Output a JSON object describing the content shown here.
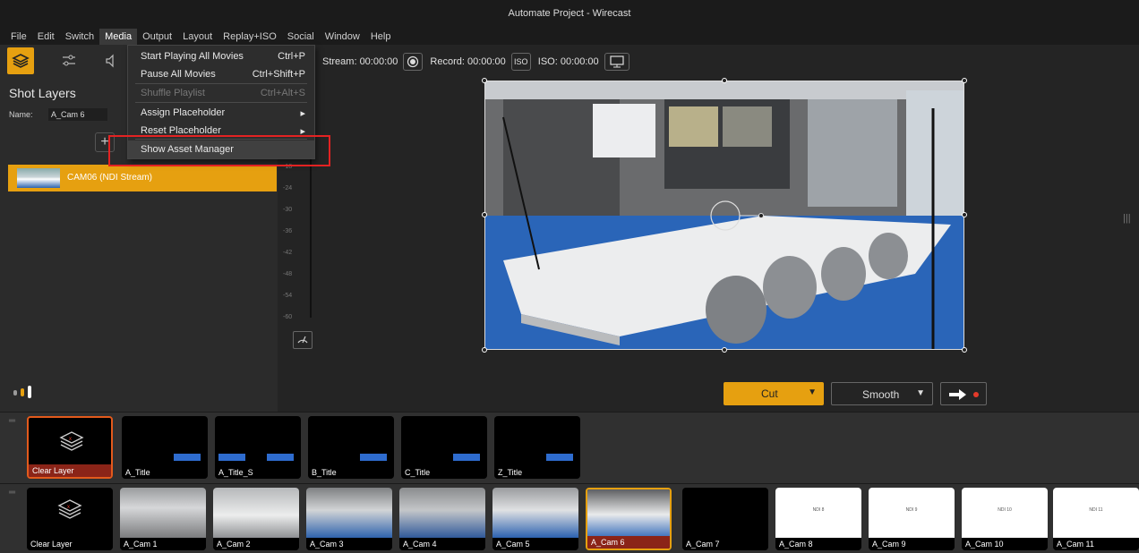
{
  "window": {
    "title": "Automate Project - Wirecast"
  },
  "menubar": {
    "items": [
      "File",
      "Edit",
      "Switch",
      "Media",
      "Output",
      "Layout",
      "Replay+ISO",
      "Social",
      "Window",
      "Help"
    ],
    "active": "Media"
  },
  "media_menu": {
    "items": [
      {
        "label": "Start Playing All Movies",
        "shortcut": "Ctrl+P",
        "enabled": true,
        "submenu": false
      },
      {
        "label": "Pause All Movies",
        "shortcut": "Ctrl+Shift+P",
        "enabled": true,
        "submenu": false
      },
      {
        "label": "Shuffle Playlist",
        "shortcut": "Ctrl+Alt+S",
        "enabled": false,
        "submenu": false
      },
      {
        "label": "Assign Placeholder",
        "shortcut": "",
        "enabled": true,
        "submenu": true
      },
      {
        "label": "Reset Placeholder",
        "shortcut": "",
        "enabled": true,
        "submenu": true
      },
      {
        "label": "Show Asset Manager",
        "shortcut": "",
        "enabled": true,
        "submenu": false,
        "highlighted": true
      }
    ]
  },
  "left_panel": {
    "title": "Shot Layers",
    "name_label": "Name:",
    "name_value": "A_Cam 6",
    "add_button": "+",
    "layer": {
      "label": "CAM06 (NDI Stream)"
    }
  },
  "meter": {
    "ticks": [
      "-18",
      "-24",
      "-30",
      "-36",
      "-42",
      "-48",
      "-54",
      "-60"
    ]
  },
  "status": {
    "stream": "Stream: 00:00:00",
    "record": "Record: 00:00:00",
    "iso": "ISO: 00:00:00",
    "iso_badge": "ISO"
  },
  "transition": {
    "cut": "Cut",
    "smooth": "Smooth"
  },
  "strip1": {
    "shots": [
      "Clear Layer",
      "A_Title",
      "A_Title_S",
      "B_Title",
      "C_Title",
      "Z_Title"
    ]
  },
  "strip2": {
    "shots": [
      "Clear Layer",
      "A_Cam 1",
      "A_Cam 2",
      "A_Cam 3",
      "A_Cam 4",
      "A_Cam 5",
      "A_Cam 6",
      "A_Cam 7",
      "A_Cam 8",
      "A_Cam 9",
      "A_Cam 10",
      "A_Cam 11"
    ],
    "ndi_labels": [
      "NDI 8",
      "NDI 9",
      "NDI 10",
      "NDI 11"
    ]
  },
  "colors": {
    "accent": "#e6a010",
    "selected_border": "#e35a1c",
    "highlight_box": "#e32222",
    "title_blue": "#2e6ccf"
  },
  "icons": [
    "layers-icon",
    "sliders-icon",
    "speaker-icon",
    "record-icon",
    "iso-icon",
    "monitor-icon",
    "arrow-right-icon",
    "record-dot-icon",
    "meter-reset-icon"
  ]
}
